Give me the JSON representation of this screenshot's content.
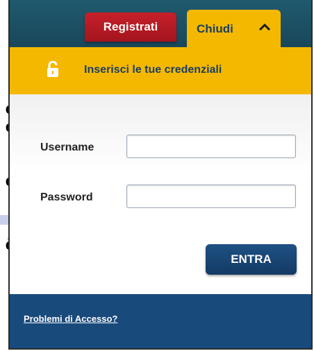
{
  "header": {
    "register_label": "Registrati",
    "close_label": "Chiudi",
    "close_icon": "chevron-up-icon"
  },
  "banner": {
    "icon": "lock-icon",
    "text": "Inserisci le tue credenziali"
  },
  "form": {
    "username_label": "Username",
    "username_value": "",
    "password_label": "Password",
    "password_value": "",
    "submit_label": "ENTRA"
  },
  "footer": {
    "access_problem_link": "Problemi di Accesso?"
  },
  "background_fragments": [
    "e",
    "e",
    "i",
    "e",
    "è"
  ],
  "colors": {
    "header_bg": "#1f5a6e",
    "register_red": "#c7202a",
    "accent_yellow": "#f5b800",
    "text_navy": "#1a3f60",
    "button_blue": "#1e5184",
    "footer_blue": "#194a7c"
  }
}
